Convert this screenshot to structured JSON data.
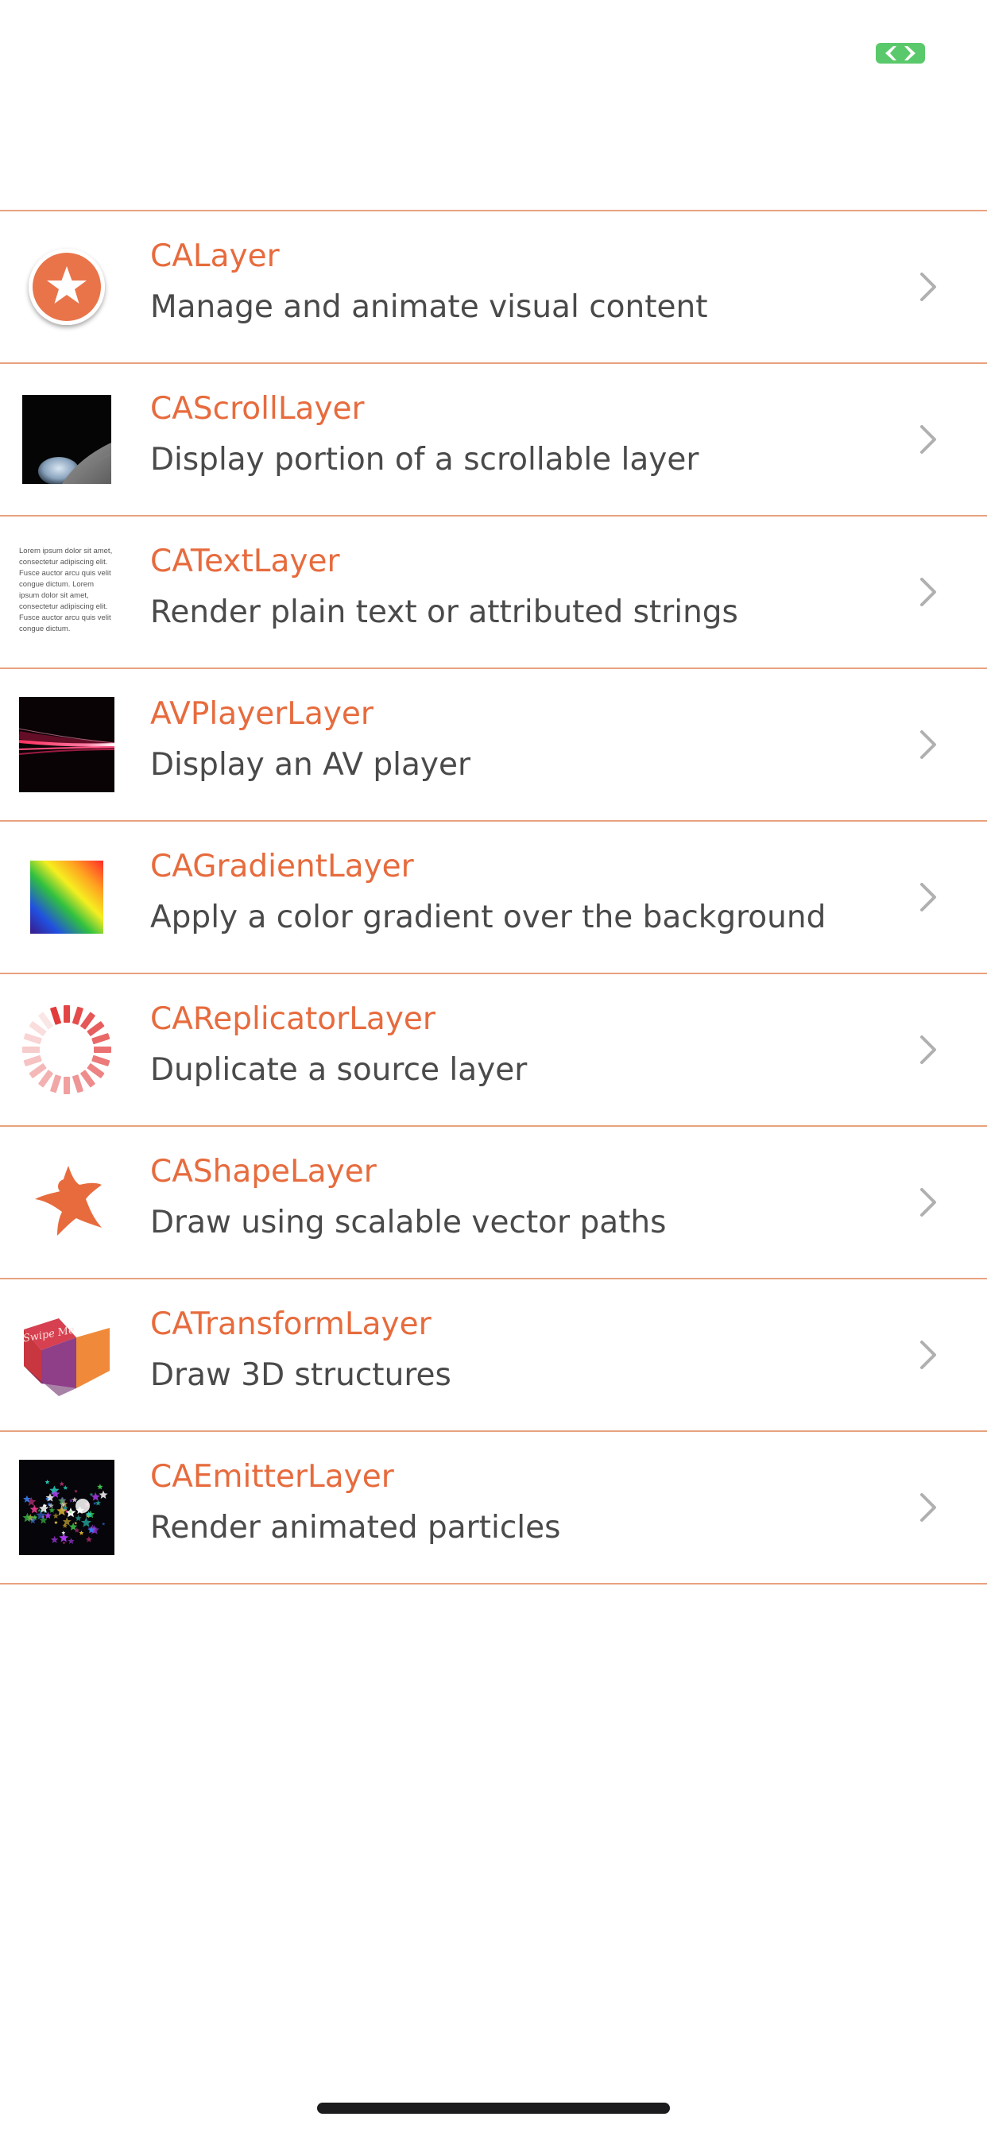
{
  "status": {
    "icon": "battery-icon",
    "color": "#5ac96b"
  },
  "theme": {
    "accent": "#e76b3d",
    "divider": "#e8a27e",
    "subtitle": "#4a4a4a",
    "chevron": "#b0b0b0"
  },
  "rows": [
    {
      "title": "CALayer",
      "subtitle": "Manage and animate visual content",
      "icon": "star-badge-icon"
    },
    {
      "title": "CAScrollLayer",
      "subtitle": "Display portion of a scrollable layer",
      "icon": "moon-photo-icon"
    },
    {
      "title": "CATextLayer",
      "subtitle": "Render plain text or attributed strings",
      "icon": "lorem-text-icon",
      "thumb_text": "Lorem ipsum dolor sit amet, consectetur adipiscing elit. Fusce auctor arcu quis velit congue dictum. Lorem ipsum dolor sit amet, consectetur adipiscing elit. Fusce auctor arcu quis velit congue dictum."
    },
    {
      "title": "AVPlayerLayer",
      "subtitle": "Display an AV player",
      "icon": "video-streak-icon"
    },
    {
      "title": "CAGradientLayer",
      "subtitle": "Apply a color gradient over the background",
      "icon": "gradient-square-icon"
    },
    {
      "title": "CAReplicatorLayer",
      "subtitle": "Duplicate a source layer",
      "icon": "replicator-spinner-icon"
    },
    {
      "title": "CAShapeLayer",
      "subtitle": "Draw using scalable vector paths",
      "icon": "shape-star-icon"
    },
    {
      "title": "CATransformLayer",
      "subtitle": "Draw 3D structures",
      "icon": "cube-icon",
      "thumb_text": "Swipe Me"
    },
    {
      "title": "CAEmitterLayer",
      "subtitle": "Render animated particles",
      "icon": "particles-icon"
    }
  ]
}
